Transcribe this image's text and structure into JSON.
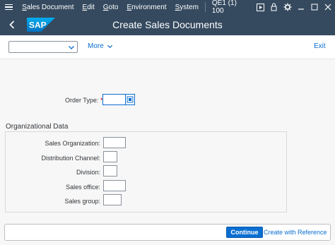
{
  "menubar": {
    "items": [
      "Sales Document",
      "Edit",
      "Goto",
      "Environment",
      "System"
    ],
    "sysinfo": "QE1 (1) 100",
    "icons": [
      "hamburger-icon",
      "play-icon",
      "lock-icon",
      "settings-icon",
      "minimize-icon",
      "maximize-icon",
      "close-icon"
    ]
  },
  "titlebar": {
    "title": "Create Sales Documents",
    "logo": "SAP",
    "brand_color": "#0a6ed1",
    "bar_color": "#354a5f"
  },
  "toolbar": {
    "dropdown_value": "",
    "more_label": "More",
    "exit_label": "Exit"
  },
  "form": {
    "order_type_label": "Order Type:",
    "order_type_required": "*",
    "order_type_value": ""
  },
  "org": {
    "title": "Organizational Data",
    "fields": [
      {
        "label": "Sales Organization:",
        "value": ""
      },
      {
        "label": "Distribution Channel:",
        "value": ""
      },
      {
        "label": "Division:",
        "value": ""
      },
      {
        "label": "Sales office:",
        "value": ""
      },
      {
        "label": "Sales group:",
        "value": ""
      }
    ]
  },
  "footer": {
    "continue_label": "Continue",
    "create_ref_label": "Create with Reference"
  }
}
